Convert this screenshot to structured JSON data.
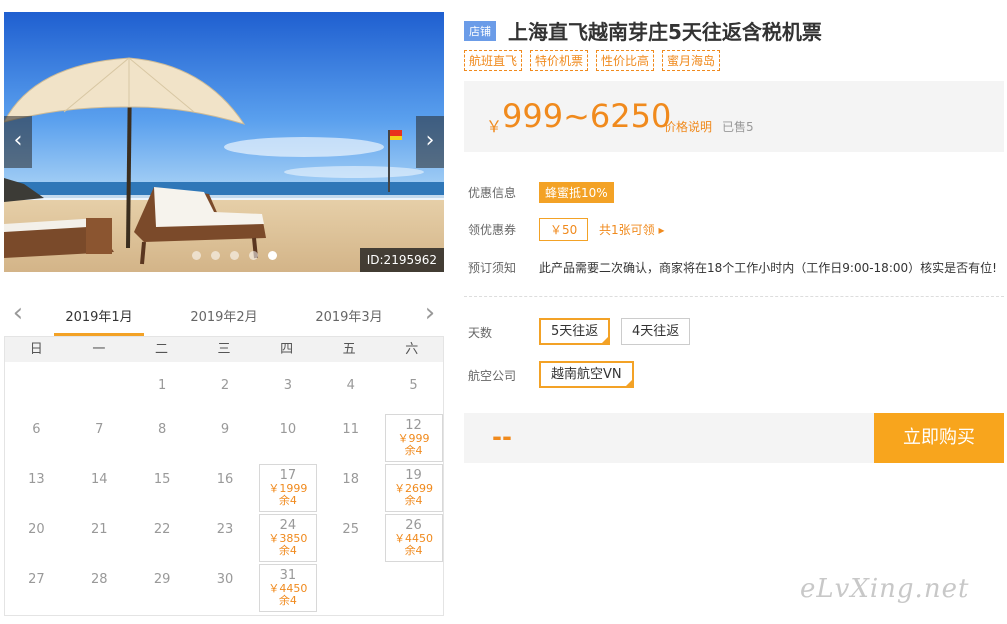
{
  "photo": {
    "id_label": "ID:2195962",
    "prev_icon": "chevron-left-icon",
    "next_icon": "chevron-right-icon",
    "slide_count": 5,
    "active_slide": 5
  },
  "calendar": {
    "prev_icon": "chevron-left-icon",
    "next_icon": "chevron-right-icon",
    "months": [
      "2019年1月",
      "2019年2月",
      "2019年3月"
    ],
    "active_month": "2019年1月",
    "weekdays": [
      "日",
      "一",
      "二",
      "三",
      "四",
      "五",
      "六"
    ],
    "weeks": [
      [
        null,
        null,
        {
          "d": "1"
        },
        {
          "d": "2"
        },
        {
          "d": "3"
        },
        {
          "d": "4"
        },
        {
          "d": "5"
        }
      ],
      [
        {
          "d": "6"
        },
        {
          "d": "7"
        },
        {
          "d": "8"
        },
        {
          "d": "9"
        },
        {
          "d": "10"
        },
        {
          "d": "11"
        },
        {
          "d": "12",
          "price": "￥999",
          "stock": "余4"
        }
      ],
      [
        {
          "d": "13"
        },
        {
          "d": "14"
        },
        {
          "d": "15"
        },
        {
          "d": "16"
        },
        {
          "d": "17",
          "price": "￥1999",
          "stock": "余4"
        },
        {
          "d": "18"
        },
        {
          "d": "19",
          "price": "￥2699",
          "stock": "余4"
        }
      ],
      [
        {
          "d": "20"
        },
        {
          "d": "21"
        },
        {
          "d": "22"
        },
        {
          "d": "23"
        },
        {
          "d": "24",
          "price": "￥3850",
          "stock": "余4"
        },
        {
          "d": "25"
        },
        {
          "d": "26",
          "price": "￥4450",
          "stock": "余4"
        }
      ],
      [
        {
          "d": "27"
        },
        {
          "d": "28"
        },
        {
          "d": "29"
        },
        {
          "d": "30"
        },
        {
          "d": "31",
          "price": "￥4450",
          "stock": "余4"
        },
        null,
        null
      ]
    ]
  },
  "product": {
    "shop_badge": "店铺",
    "title": "上海直飞越南芽庄5天往返含税机票",
    "tags": [
      "航班直飞",
      "特价机票",
      "性价比高",
      "蜜月海岛"
    ],
    "currency": "￥",
    "price_range": "999~6250",
    "price_note": "价格说明",
    "sold": "已售5",
    "promo_label": "优惠信息",
    "promo_badge": "蜂蜜抵10%",
    "coupon_label": "领优惠券",
    "coupon_value": "￥50",
    "coupon_link": "共1张可领 ▸",
    "notice_label": "预订须知",
    "notice_text": "此产品需要二次确认，商家将在18个工作小时内（工作日9:00-18:00）核实是否有位!",
    "days_label": "天数",
    "days_options": [
      "5天往返",
      "4天往返"
    ],
    "days_selected": "5天往返",
    "airline_label": "航空公司",
    "airline_options": [
      "越南航空VN"
    ],
    "airline_selected": "越南航空VN",
    "total": "--",
    "buy_button": "立即购买"
  },
  "watermark": "eLvXing.net",
  "colors": {
    "accent": "#f08a1d",
    "button": "#f8a51d",
    "shop_badge": "#6b9ce8"
  }
}
